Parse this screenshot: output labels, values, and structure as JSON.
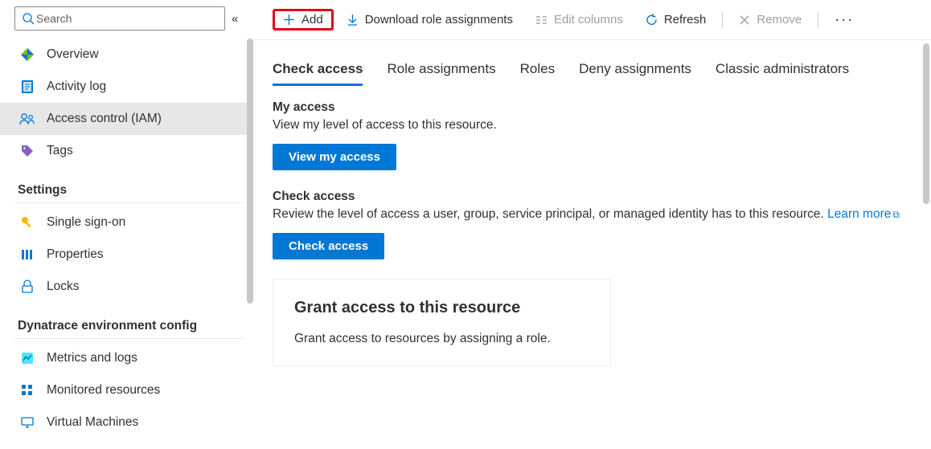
{
  "search": {
    "placeholder": "Search"
  },
  "sidebar": {
    "items": [
      {
        "label": "Overview"
      },
      {
        "label": "Activity log"
      },
      {
        "label": "Access control (IAM)"
      },
      {
        "label": "Tags"
      }
    ],
    "section_settings": "Settings",
    "settings_items": [
      {
        "label": "Single sign-on"
      },
      {
        "label": "Properties"
      },
      {
        "label": "Locks"
      }
    ],
    "section_dynatrace": "Dynatrace environment config",
    "dynatrace_items": [
      {
        "label": "Metrics and logs"
      },
      {
        "label": "Monitored resources"
      },
      {
        "label": "Virtual Machines"
      }
    ]
  },
  "toolbar": {
    "add": "Add",
    "download": "Download role assignments",
    "edit_columns": "Edit columns",
    "refresh": "Refresh",
    "remove": "Remove"
  },
  "tabs": [
    "Check access",
    "Role assignments",
    "Roles",
    "Deny assignments",
    "Classic administrators"
  ],
  "my_access": {
    "title": "My access",
    "desc": "View my level of access to this resource.",
    "button": "View my access"
  },
  "check_access": {
    "title": "Check access",
    "desc": "Review the level of access a user, group, service principal, or managed identity has to this resource. ",
    "link": "Learn more",
    "button": "Check access"
  },
  "grant_card": {
    "title": "Grant access to this resource",
    "desc": "Grant access to resources by assigning a role."
  }
}
